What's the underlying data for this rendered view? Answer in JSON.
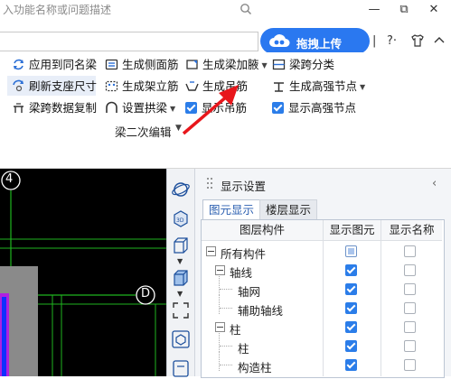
{
  "header": {
    "search_placeholder": "入功能名称或问题描述",
    "upload_label": "拖拽上传",
    "help_label": "?·",
    "window_controls": [
      "minimize",
      "maximize",
      "close"
    ]
  },
  "ribbon": {
    "group_label": "梁二次编辑",
    "col1": [
      "应用到同名梁",
      "刷新支座尺寸",
      "梁跨数据复制"
    ],
    "col2": [
      "生成侧面筋",
      "生成架立筋",
      "设置拱梁"
    ],
    "col3": [
      "生成梁加腋",
      "生成吊筋",
      "显示吊筋"
    ],
    "col4": [
      "梁跨分类",
      "生成高强节点",
      "显示高强节点"
    ],
    "accent_color": "#2b7de9",
    "arrow_color": "#e8161b"
  },
  "cad": {
    "axis_labels": [
      "4",
      "D"
    ],
    "background": "#000000"
  },
  "panel": {
    "title": "显示设置",
    "tabs": [
      "图元显示",
      "楼层显示"
    ],
    "columns": [
      "图层构件",
      "显示图元",
      "显示名称"
    ],
    "rows": [
      {
        "label": "所有构件",
        "level": 0,
        "toggle": true,
        "show": "partial",
        "name": "off"
      },
      {
        "label": "轴线",
        "level": 1,
        "toggle": true,
        "show": "on",
        "name": "off"
      },
      {
        "label": "轴网",
        "level": 2,
        "toggle": false,
        "show": "on",
        "name": "off"
      },
      {
        "label": "辅助轴线",
        "level": 2,
        "toggle": false,
        "show": "on",
        "name": "off"
      },
      {
        "label": "柱",
        "level": 1,
        "toggle": true,
        "show": "on",
        "name": "off"
      },
      {
        "label": "柱",
        "level": 2,
        "toggle": false,
        "show": "on",
        "name": "off"
      },
      {
        "label": "构造柱",
        "level": 2,
        "toggle": false,
        "show": "on",
        "name": "off"
      }
    ]
  }
}
